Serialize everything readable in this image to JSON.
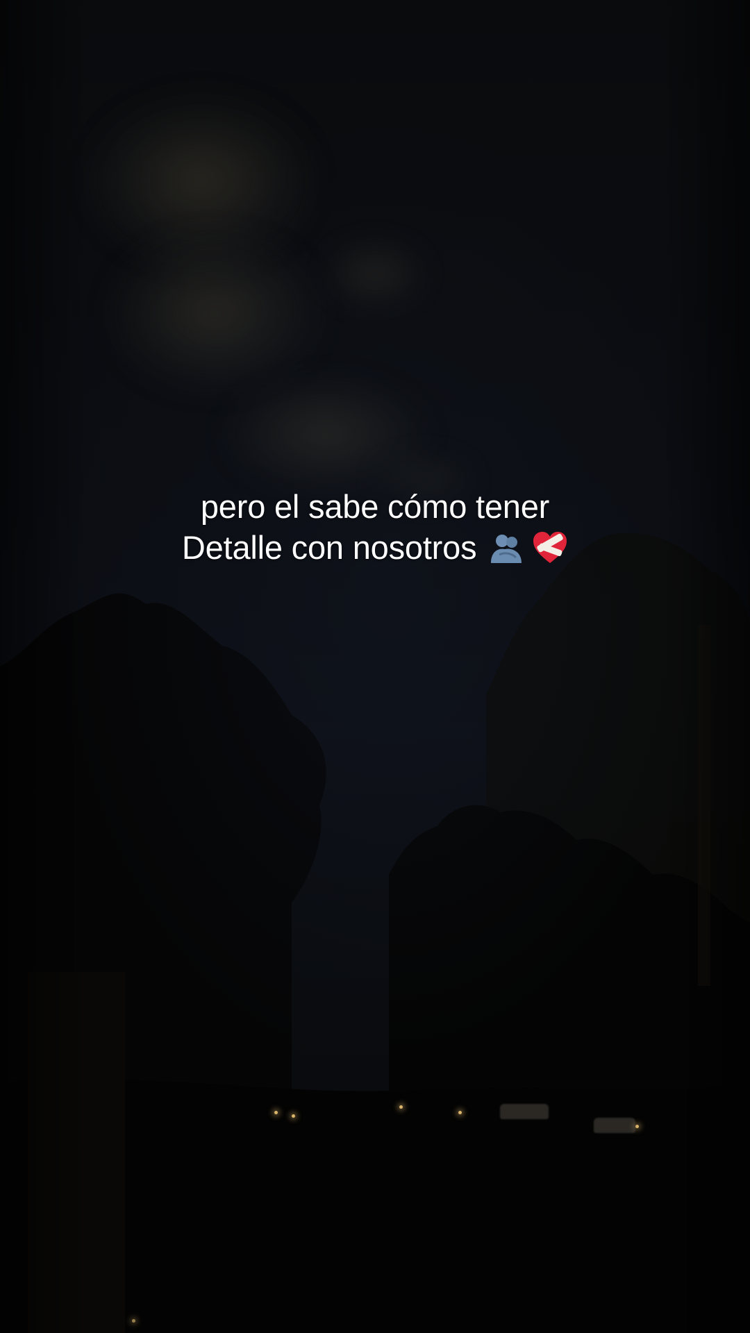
{
  "caption": {
    "line1": "pero el sabe cómo tener",
    "line2": "Detalle con nosotros"
  },
  "icons": [
    "hugging-people-icon",
    "mending-heart-icon"
  ],
  "colors": {
    "sky": "#0b0d12",
    "text": "#ffffff",
    "cloud": "#403c30",
    "lights": "#d9b46a"
  }
}
